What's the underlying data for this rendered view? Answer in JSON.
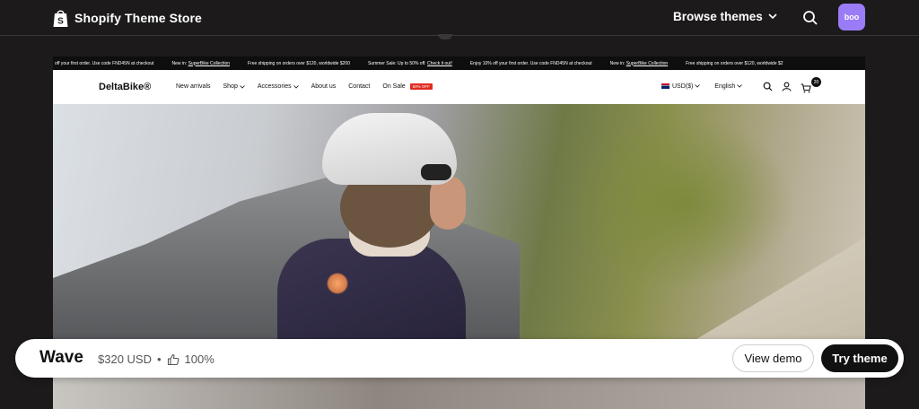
{
  "topbar": {
    "store_name": "Shopify Theme Store",
    "browse_label": "Browse themes",
    "avatar_text": "boo"
  },
  "preview": {
    "ticker": [
      {
        "text": "off your first order. Use code FND45N at checkout",
        "link": ""
      },
      {
        "text": "New in:",
        "link": "SuperBike Collection"
      },
      {
        "text": "Free shipping on orders over $120, worldwide $200",
        "link": ""
      },
      {
        "text": "Summer Sale: Up to 50% off.",
        "link": "Check it out!"
      },
      {
        "text": "Enjoy 10% off your first order. Use code FND45N at checkout",
        "link": ""
      },
      {
        "text": "New in:",
        "link": "SuperBike Collection"
      },
      {
        "text": "Free shipping on orders over $120, worldwide $2",
        "link": ""
      }
    ],
    "brand": "DeltaBike®",
    "nav": [
      "New arrivals",
      "Shop",
      "Accessories",
      "About us",
      "Contact",
      "On Sale"
    ],
    "sale_badge": "50% OFF",
    "currency": "USD($)",
    "language": "English",
    "cart_count": "20"
  },
  "theme_bar": {
    "name": "Wave",
    "price": "$320 USD",
    "separator": "•",
    "rating": "100%",
    "view_demo": "View demo",
    "try_theme": "Try theme"
  },
  "colors": {
    "page_bg": "#1c1a1a",
    "avatar_bg": "#9a7cf7",
    "sale_badge": "#e02b20",
    "primary_button": "#111111"
  },
  "icons": [
    "shopify-bag-icon",
    "chevron-down-icon",
    "search-icon",
    "user-icon",
    "cart-icon",
    "thumbs-up-icon"
  ]
}
